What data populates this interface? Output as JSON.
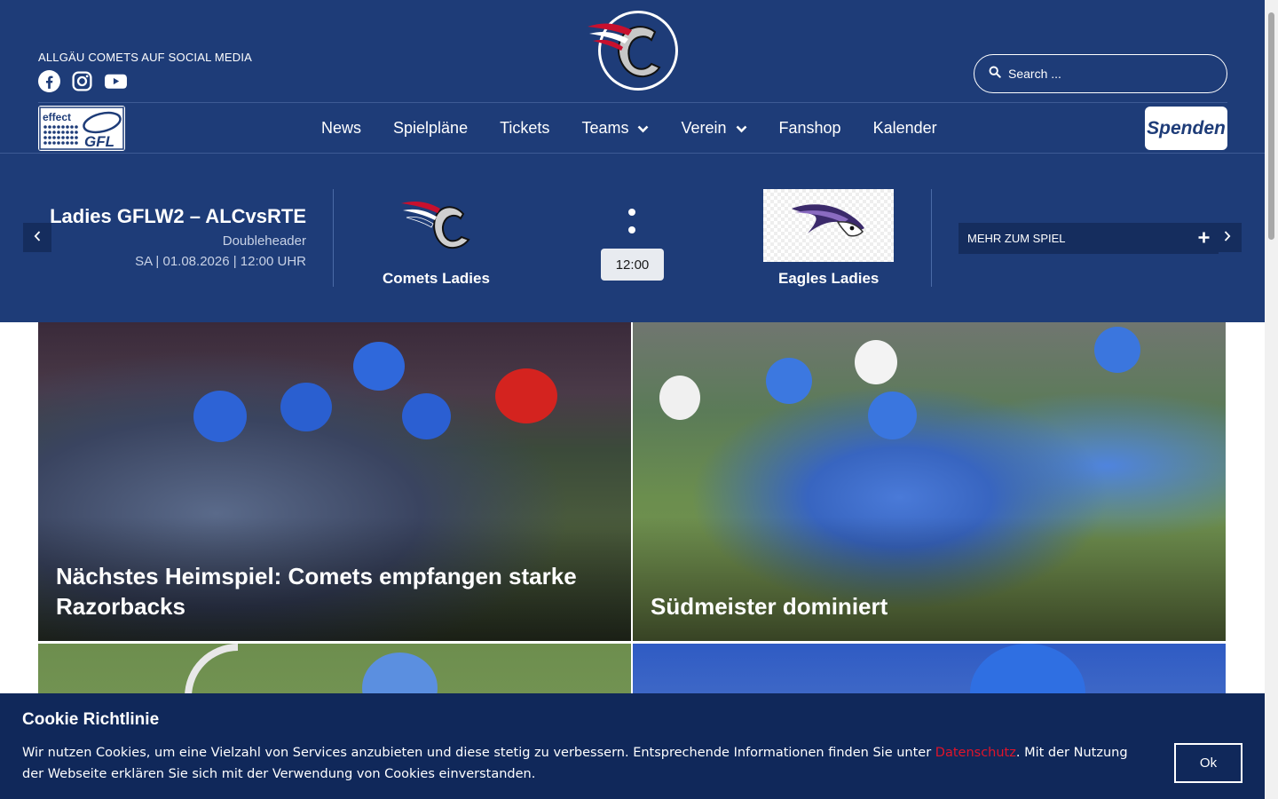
{
  "header": {
    "social_label": "ALLGÄU COMETS AUF SOCIAL MEDIA",
    "social_icons": [
      "facebook-icon",
      "instagram-icon",
      "youtube-icon"
    ],
    "search_placeholder": "Search ...",
    "gfl_logo_text": "effect GFL",
    "donate_label": "Spenden"
  },
  "nav": {
    "items": [
      {
        "label": "News"
      },
      {
        "label": "Spielpläne"
      },
      {
        "label": "Tickets"
      },
      {
        "label": "Teams"
      },
      {
        "label": "Verein"
      },
      {
        "label": "Fanshop"
      },
      {
        "label": "Kalender"
      }
    ]
  },
  "match": {
    "title": "Ladies GFLW2 – ALCvsRTE",
    "subtitle": "Doubleheader",
    "date": "SA | 01.08.2026 | 12:00 UHR",
    "home_team": "Comets Ladies",
    "away_team": "Eagles Ladies",
    "kickoff": "12:00",
    "more_label": "MEHR ZUM SPIEL"
  },
  "articles": [
    {
      "title": "Nächstes Heimspiel: Comets empfangen starke Razorbacks"
    },
    {
      "title": "Südmeister dominiert"
    }
  ],
  "cookie": {
    "title": "Cookie Richtlinie",
    "text_before": "Wir nutzen Cookies, um eine Vielzahl von Services anzubieten und diese stetig zu verbessern. Entsprechende Informationen finden Sie unter ",
    "link_label": "Datenschutz",
    "text_after": ". Mit der Nutzung der Webseite erklären Sie sich mit der Verwendung von Cookies einverstanden.",
    "ok_label": "Ok"
  },
  "colors": {
    "brand_blue": "#1e3c78",
    "cookie_bg": "#10285a",
    "link_red": "#e0142a"
  }
}
